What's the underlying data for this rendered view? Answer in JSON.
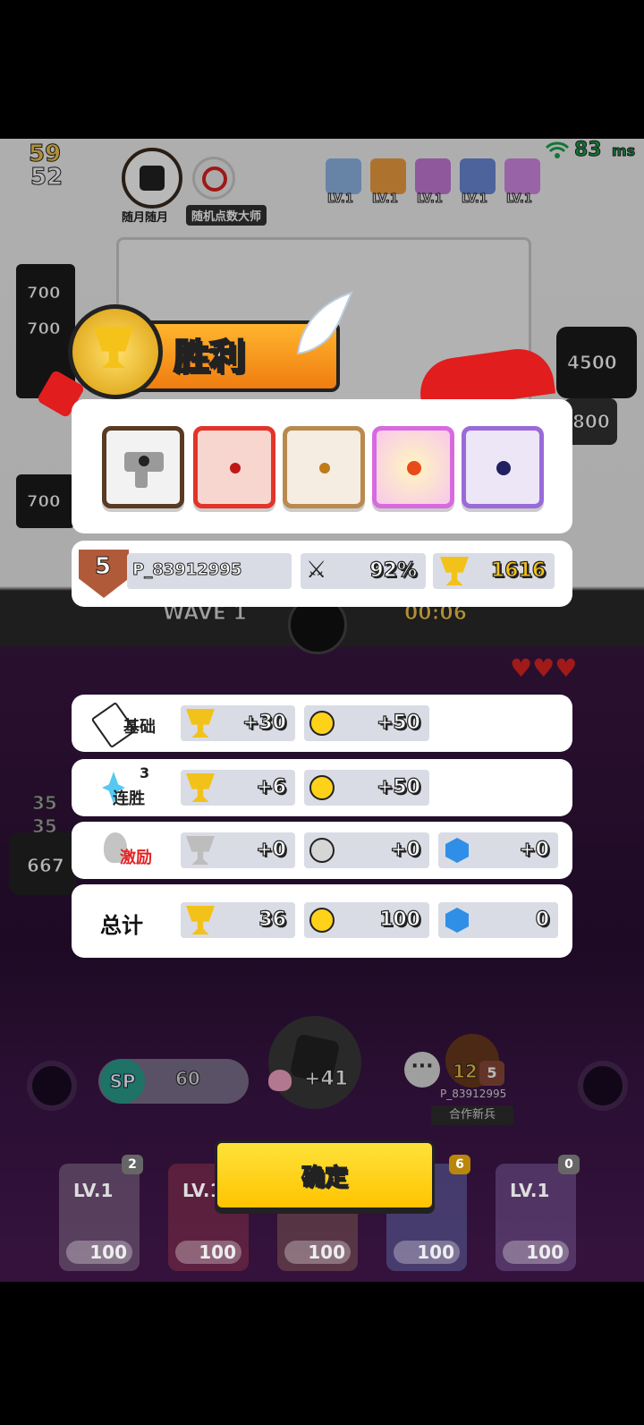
{
  "hud": {
    "top_num": "59",
    "bottom_num": "52",
    "ping": "83",
    "ping_unit": "ms",
    "player_tag": "随月随月",
    "mode_tag": "随机点数大师",
    "level_labels": [
      "LV.1",
      "LV.1",
      "LV.1",
      "LV.1",
      "LV.1"
    ],
    "enemy_hp": [
      "700",
      "700",
      "700",
      "700",
      "4500",
      "800",
      "667"
    ],
    "wave_label": "WAVE 1",
    "timer": "00:06",
    "left_nums": [
      "35",
      "35"
    ]
  },
  "victory": {
    "title": "胜利"
  },
  "player_row": {
    "rank": "5",
    "name": "P_83912995",
    "win_rate": "92%",
    "trophies": "1616"
  },
  "rewards": [
    {
      "label": "基础",
      "trophy": "+30",
      "coin": "+50",
      "gem": null
    },
    {
      "label": "连胜",
      "streak": "3",
      "trophy": "+6",
      "coin": "+50",
      "gem": null
    },
    {
      "label": "激励",
      "trophy": "+0",
      "coin": "+0",
      "gem": "+0"
    },
    {
      "label": "总计",
      "trophy": "36",
      "coin": "100",
      "gem": "0"
    }
  ],
  "bottom": {
    "sp_label": "SP",
    "sp_value": "60",
    "bonus": "+41",
    "partner_level": "12",
    "partner_rank": "5",
    "partner_name": "P_83912995",
    "partner_tag": "合作新兵",
    "confirm": "确定",
    "dice": [
      {
        "lv": "LV.1",
        "cost": "100",
        "count": "2"
      },
      {
        "lv": "LV.1",
        "cost": "100",
        "count": ""
      },
      {
        "lv": "",
        "cost": "100",
        "count": ""
      },
      {
        "lv": "",
        "cost": "100",
        "count": "6"
      },
      {
        "lv": "LV.1",
        "cost": "100",
        "count": "0"
      }
    ]
  },
  "colors": {
    "gold": "#f3c21a",
    "banner_orange": "#f39a17",
    "gem_blue": "#2f8fe8",
    "confirm_yellow": "#ffd400"
  }
}
